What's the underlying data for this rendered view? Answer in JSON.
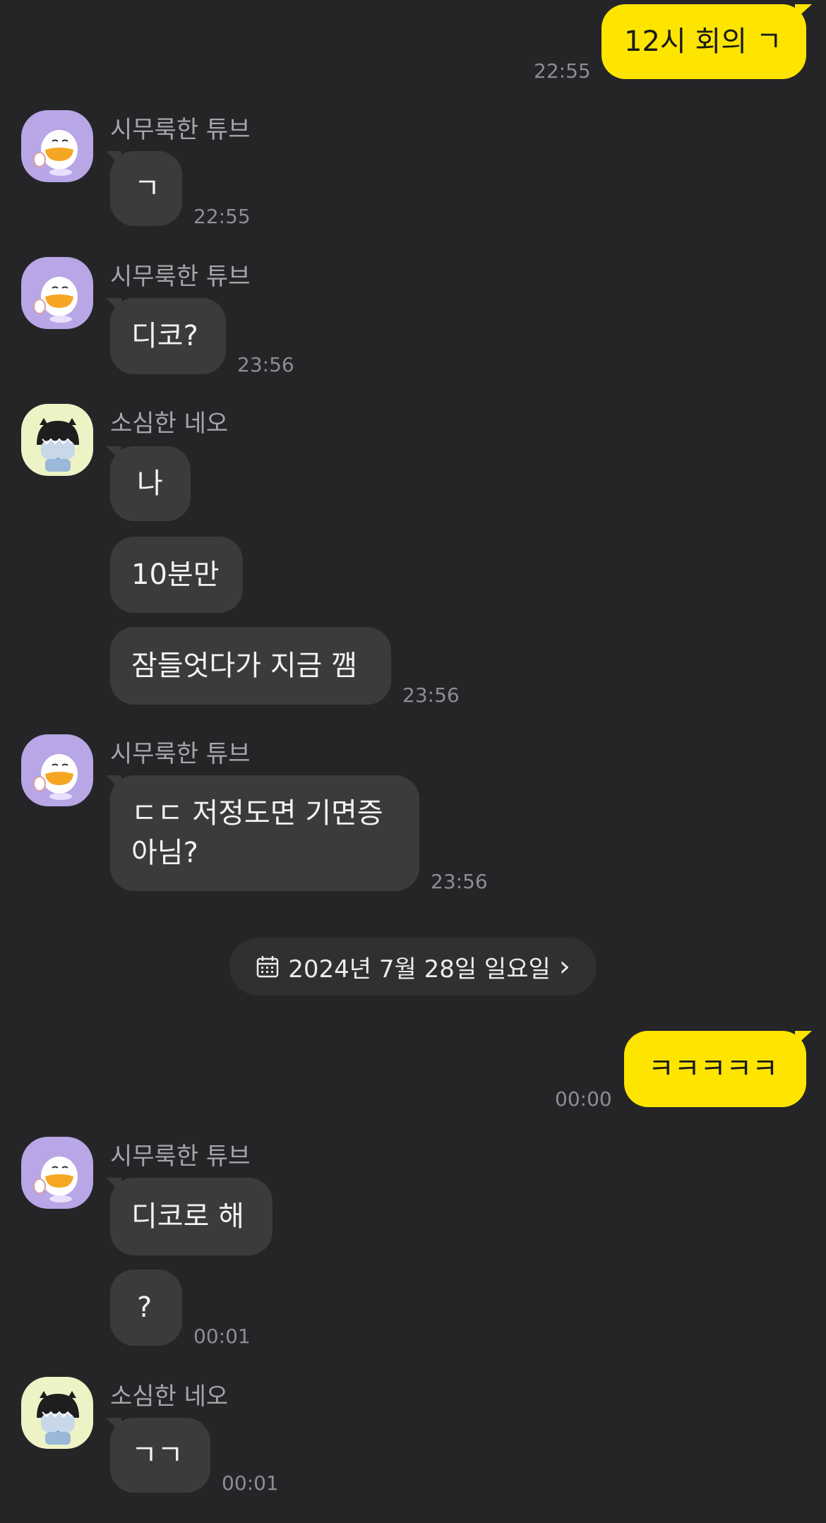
{
  "messages": {
    "m1": {
      "text": "12시 회의 ㄱ",
      "time": "22:55"
    },
    "m2": {
      "sender": "시무룩한 튜브",
      "text": "ㄱ",
      "time": "22:55"
    },
    "m3": {
      "sender": "시무룩한 튜브",
      "text": "디코?",
      "time": "23:56"
    },
    "m4": {
      "sender": "소심한 네오",
      "texts": [
        "나",
        "10분만",
        "잠들엇다가 지금 깸"
      ],
      "time": "23:56"
    },
    "m5": {
      "sender": "시무룩한 튜브",
      "text_line1": "ㄷㄷ 저정도면 기면증",
      "text_line2": "아님?",
      "time": "23:56"
    },
    "date_divider": {
      "label": "2024년 7월 28일 일요일",
      "icon": "calendar-icon",
      "chevron": "›"
    },
    "m6": {
      "text": "ㅋㅋㅋㅋㅋ",
      "time": "00:00"
    },
    "m7": {
      "sender": "시무룩한 튜브",
      "texts": [
        "디코로 해",
        "?"
      ],
      "time": "00:01"
    },
    "m8": {
      "sender": "소심한 네오",
      "text": "ㄱㄱ",
      "time": "00:01"
    }
  },
  "avatars": {
    "tube": "duck-character-avatar",
    "neo": "cat-character-avatar"
  },
  "colors": {
    "background": "#252527",
    "my_bubble": "#fee500",
    "other_bubble": "#3b3b3d",
    "timestamp": "#8e8e92",
    "sender_name": "#a6a6aa",
    "tube_avatar_bg": "#b8a6e6",
    "neo_avatar_bg": "#eef3c6"
  }
}
